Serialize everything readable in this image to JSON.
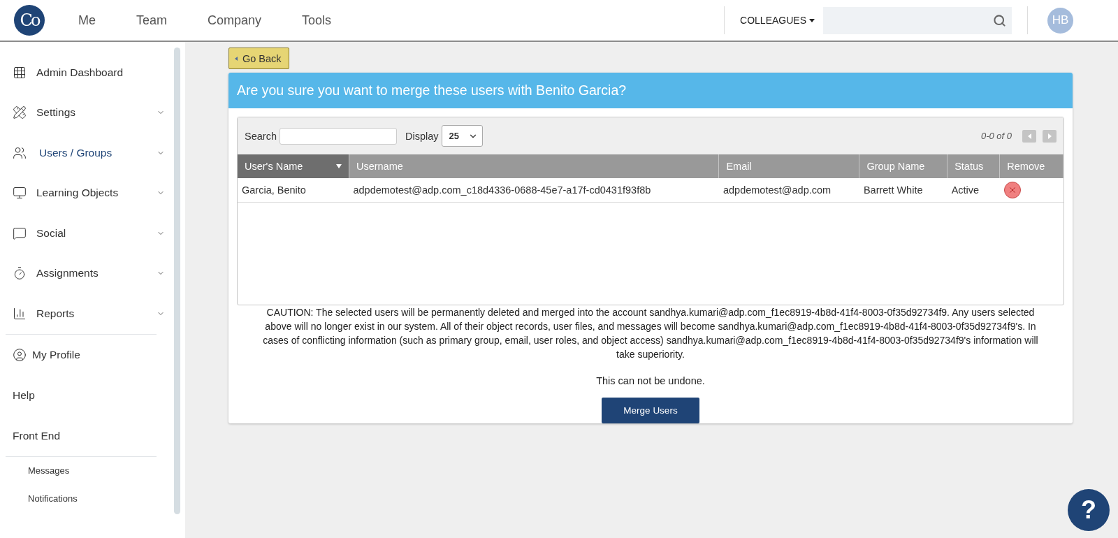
{
  "logo": {
    "text": "Co"
  },
  "nav": [
    {
      "label": "Me",
      "selected": false
    },
    {
      "label": "Team",
      "selected": false
    },
    {
      "label": "Company",
      "selected": false
    },
    {
      "label": "Tools",
      "selected": false
    }
  ],
  "header": {
    "scope": "COLLEAGUES",
    "avatar": "HB"
  },
  "sidebar": {
    "items": [
      {
        "label": "Admin Dashboard",
        "kind": "link",
        "selected": false
      },
      {
        "label": "Settings",
        "kind": "menu",
        "selected": false,
        "expanded": false
      },
      {
        "label": "Users / Groups",
        "kind": "menu",
        "selected": true,
        "expanded": false
      },
      {
        "label": "Learning Objects",
        "kind": "menu",
        "selected": false,
        "expanded": false
      },
      {
        "label": "Social",
        "kind": "menu",
        "selected": false,
        "expanded": false
      },
      {
        "label": "Assignments",
        "kind": "menu",
        "selected": false,
        "expanded": false
      },
      {
        "label": "Reports",
        "kind": "menu",
        "selected": false,
        "expanded": false
      }
    ],
    "profile": [
      {
        "label": "My Profile",
        "kind": "icon"
      },
      {
        "label": "Help",
        "kind": "plain"
      },
      {
        "label": "Front End",
        "kind": "plain"
      }
    ],
    "sub_items": [
      "Messages",
      "Notifications"
    ]
  },
  "back_button": "Go Back",
  "dialog": {
    "title": "Are you sure you want to merge these users with Benito Garcia?",
    "search_label": "Search",
    "display_label": "Display",
    "display_value": "25",
    "pagination": "0-0 of 0",
    "table": {
      "columns": [
        {
          "label": "User's Name",
          "sorted": true
        },
        {
          "label": "Username",
          "sorted": false
        },
        {
          "label": "Email",
          "sorted": false
        },
        {
          "label": "Group Name",
          "sorted": false
        },
        {
          "label": "Status",
          "sorted": false
        },
        {
          "label": "Remove",
          "sorted": false
        }
      ],
      "rows": [
        {
          "name": "Garcia, Benito",
          "username": "adpdemotest@adp.com_c18d4336-0688-45e7-a17f-cd0431f93f8b",
          "email": "adpdemotest@adp.com",
          "group": "Barrett White",
          "status": "Active"
        }
      ]
    },
    "caution": "CAUTION: The selected users will be permanently deleted and merged into the account sandhya.kumari@adp.com_f1ec8919-4b8d-41f4-8003-0f35d92734f9. Any users selected above will no longer exist in our system. All of their object records, user files, and messages will become sandhya.kumari@adp.com_f1ec8919-4b8d-41f4-8003-0f35d92734f9's. In cases of conflicting information (such as primary group, email, user roles, and object access) sandhya.kumari@adp.com_f1ec8919-4b8d-41f4-8003-0f35d92734f9's information will take superiority.",
    "warning": "This can not be undone.",
    "submit": "Merge Users"
  },
  "help_button": "?"
}
